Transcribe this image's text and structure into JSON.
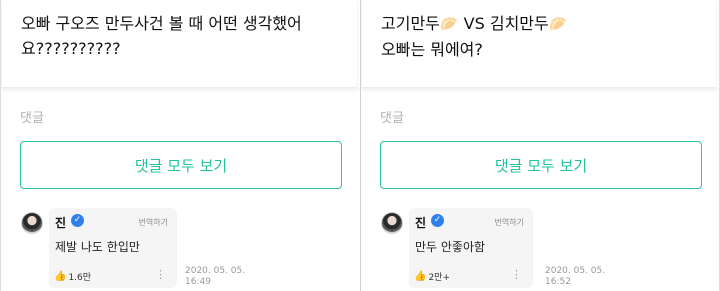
{
  "left": {
    "post_lines": [
      "오빠 구오즈 만두사건 볼 때 어떤 생각했어",
      "요??????????"
    ],
    "comments_label": "댓글",
    "view_all_label": "댓글 모두 보기",
    "comment": {
      "author": "진",
      "verified_mark": "✓",
      "translate_label": "번역하기",
      "text": "제발 나도 한입만",
      "like_count": "1.6만",
      "timestamp_lines": [
        "2020. 05. 05.",
        "16:49"
      ]
    }
  },
  "right": {
    "post_line1_a": "고기만두",
    "post_line1_emoji1": "🥟",
    "post_line1_b": " VS 김치만두",
    "post_line1_emoji2": "🥟",
    "post_line2": "오빠는 뭐에여?",
    "comments_label": "댓글",
    "view_all_label": "댓글 모두 보기",
    "comment": {
      "author": "진",
      "verified_mark": "✓",
      "translate_label": "번역하기",
      "text": "만두 안좋아함",
      "like_count": "2만+",
      "timestamp_lines": [
        "2020. 05. 05.",
        "16:52"
      ]
    }
  },
  "icons": {
    "thumbs_up": "👍",
    "more": "⋮"
  },
  "colors": {
    "accent": "#22c39e",
    "verified": "#2f80ed",
    "muted": "#b2b2b2"
  }
}
